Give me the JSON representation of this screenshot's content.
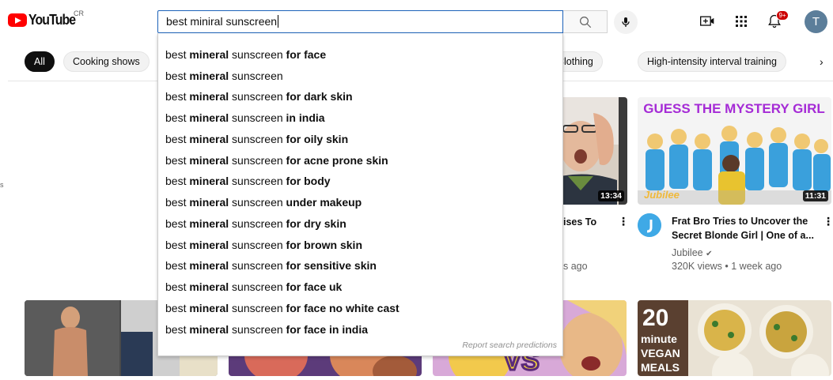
{
  "header": {
    "logo_text": "YouTube",
    "country_code": "CR",
    "search_value": "best miniral sunscreen",
    "notification_count": "9+",
    "avatar_letter": "T"
  },
  "chips": {
    "items": [
      "All",
      "Cooking shows",
      "Clothing",
      "High-intensity interval training"
    ],
    "next_arrow": "›"
  },
  "suggestions": {
    "items": [
      {
        "prefix": "best ",
        "strong": "mineral",
        "middle": " sunscreen",
        "suffix": " for face"
      },
      {
        "prefix": "best ",
        "strong": "mineral",
        "middle": " sunscreen",
        "suffix": ""
      },
      {
        "prefix": "best ",
        "strong": "mineral",
        "middle": " sunscreen",
        "suffix": " for dark skin"
      },
      {
        "prefix": "best ",
        "strong": "mineral",
        "middle": " sunscreen",
        "suffix": " in india"
      },
      {
        "prefix": "best ",
        "strong": "mineral",
        "middle": " sunscreen",
        "suffix": " for oily skin"
      },
      {
        "prefix": "best ",
        "strong": "mineral",
        "middle": " sunscreen",
        "suffix": " for acne prone skin"
      },
      {
        "prefix": "best ",
        "strong": "mineral",
        "middle": " sunscreen",
        "suffix": " for body"
      },
      {
        "prefix": "best ",
        "strong": "mineral",
        "middle": " sunscreen",
        "suffix": " under makeup"
      },
      {
        "prefix": "best ",
        "strong": "mineral",
        "middle": " sunscreen",
        "suffix": " for dry skin"
      },
      {
        "prefix": "best ",
        "strong": "mineral",
        "middle": " sunscreen",
        "suffix": " for brown skin"
      },
      {
        "prefix": "best ",
        "strong": "mineral",
        "middle": " sunscreen",
        "suffix": " for sensitive skin"
      },
      {
        "prefix": "best ",
        "strong": "mineral",
        "middle": " sunscreen",
        "suffix": " for face uk"
      },
      {
        "prefix": "best ",
        "strong": "mineral",
        "middle": " sunscreen",
        "suffix": " for face no white cast"
      },
      {
        "prefix": "best ",
        "strong": "mineral",
        "middle": " sunscreen",
        "suffix": " for face in india"
      }
    ],
    "report_label": "Report search predictions"
  },
  "videos": {
    "partial": {
      "duration": "13:34",
      "title_fragment": "ises To",
      "meta_fragment": "s ago"
    },
    "jubilee": {
      "thumb_text": "GUESS THE MYSTERY GIRL",
      "thumb_brand": "Jubilee",
      "duration": "11:31",
      "title_line1": "Frat Bro Tries to Uncover the",
      "title_line2": "Secret Blonde Girl | One of a...",
      "channel": "Jubilee",
      "verified": "✔",
      "stats": "320K views • 1 week ago"
    },
    "vegan": {
      "thumb_line1": "20",
      "thumb_line2": "minute",
      "thumb_line3": "VEGAN",
      "thumb_line4": "MEALS"
    },
    "vs": {
      "thumb_text": "VS"
    }
  },
  "colors": {
    "brand_red": "#ff0000",
    "focus_blue": "#1c62b9",
    "badge_red": "#cc0000",
    "jubilee_purple": "#a52bd6"
  },
  "edge_fragment": "s"
}
